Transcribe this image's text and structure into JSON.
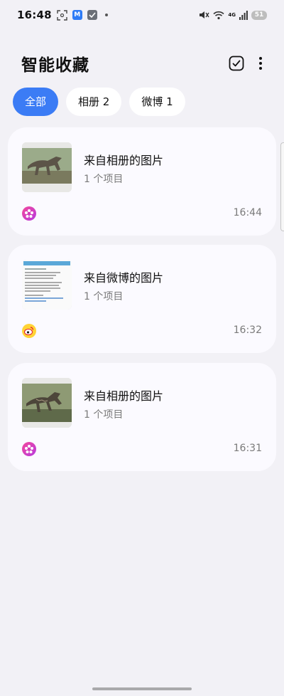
{
  "status_bar": {
    "time": "16:48",
    "app_badge": "M",
    "network": "4G",
    "battery": "51",
    "icons": [
      "screenshot-icon",
      "m-app-icon",
      "check-app-icon",
      "notification-dot",
      "mute-icon",
      "wifi-icon",
      "signal-icon",
      "battery-icon"
    ]
  },
  "header": {
    "title": "智能收藏",
    "actions": [
      "select-icon",
      "more-icon"
    ]
  },
  "filters": [
    {
      "label": "全部",
      "active": true
    },
    {
      "label": "相册 2",
      "active": false
    },
    {
      "label": "微博 1",
      "active": false
    }
  ],
  "cards": [
    {
      "title": "来自相册的图片",
      "subtitle": "1 个项目",
      "time": "16:44",
      "source": "gallery-icon"
    },
    {
      "title": "来自微博的图片",
      "subtitle": "1 个项目",
      "time": "16:32",
      "source": "weibo-icon"
    },
    {
      "title": "来自相册的图片",
      "subtitle": "1 个项目",
      "time": "16:31",
      "source": "gallery-icon"
    }
  ],
  "colors": {
    "accent": "#3b7cf5",
    "background": "#f2f1f6",
    "card": "#fbfaff",
    "secondary_text": "#7a7a7a"
  }
}
